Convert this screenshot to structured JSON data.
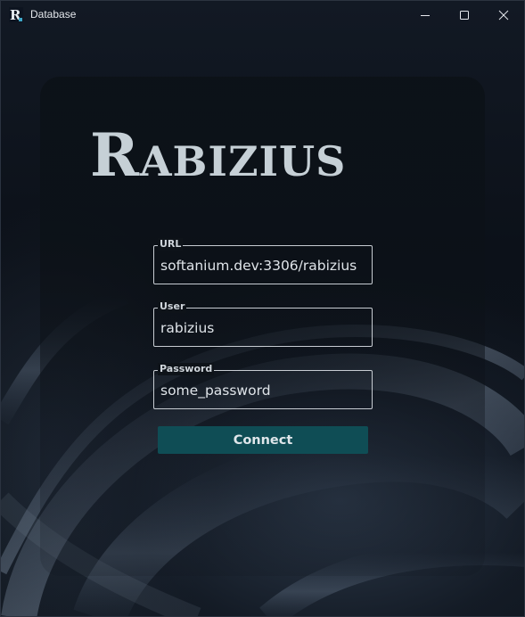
{
  "window": {
    "title": "Database",
    "controls": {
      "minimize": "minimize-icon",
      "maximize": "maximize-icon",
      "close": "close-icon"
    }
  },
  "logo": {
    "text": "Rabizius",
    "app_icon": "R"
  },
  "form": {
    "url": {
      "label": "URL",
      "value": "softanium.dev:3306/rabizius"
    },
    "user": {
      "label": "User",
      "value": "rabizius"
    },
    "password": {
      "label": "Password",
      "value": "some_password"
    },
    "connect_label": "Connect"
  },
  "colors": {
    "accent_button": "#0f4d55",
    "background": "#0c1119",
    "logo_text": "#c6d0d6"
  }
}
